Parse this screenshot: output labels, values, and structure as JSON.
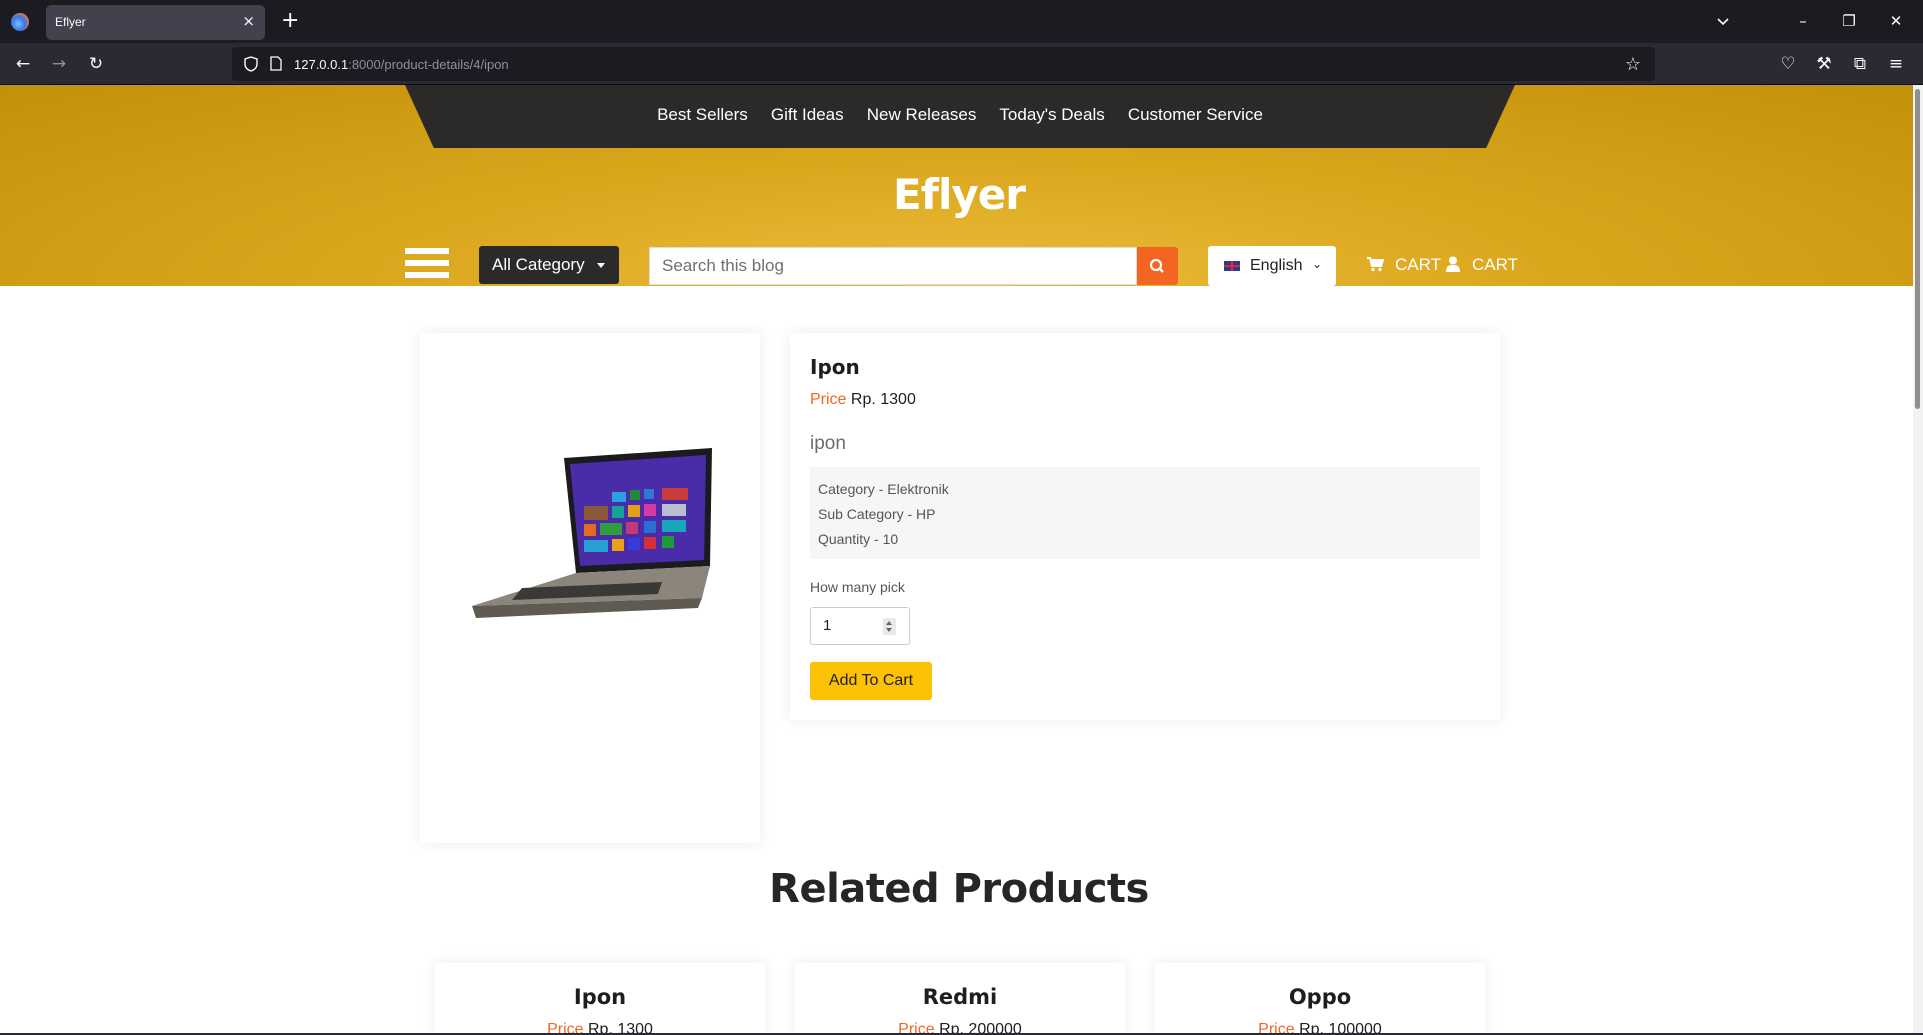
{
  "browser": {
    "tab_title": "Eflyer",
    "tab_close": "×",
    "new_tab": "+",
    "url_host": "127.0.0.1",
    "url_rest": ":8000/product-details/4/ipon"
  },
  "header": {
    "nav_links": [
      "Best Sellers",
      "Gift Ideas",
      "New Releases",
      "Today's Deals",
      "Customer Service"
    ],
    "brand": "Eflyer",
    "category_label": "All Category",
    "search_placeholder": "Search this blog",
    "language": "English",
    "cart_label_1": "CART",
    "cart_label_2": "CART"
  },
  "product": {
    "name": "Ipon",
    "price_label": "Price",
    "price_value": "Rp. 1300",
    "description": "ipon",
    "category": "Category - Elektronik",
    "sub_category": "Sub Category - HP",
    "quantity": "Quantity - 10",
    "qty_label": "How many pick",
    "qty_value": "1",
    "add_button": "Add To Cart"
  },
  "related": {
    "title": "Related Products",
    "items": [
      {
        "name": "Ipon",
        "price_label": "Price",
        "price_value": "Rp. 1300"
      },
      {
        "name": "Redmi",
        "price_label": "Price",
        "price_value": "Rp. 200000"
      },
      {
        "name": "Oppo",
        "price_label": "Price",
        "price_value": "Rp. 100000"
      }
    ]
  },
  "colors": {
    "accent_orange": "#f26522",
    "button_yellow": "#fdc106",
    "header_gold": "#daa61c",
    "dark": "#2b2a28"
  }
}
